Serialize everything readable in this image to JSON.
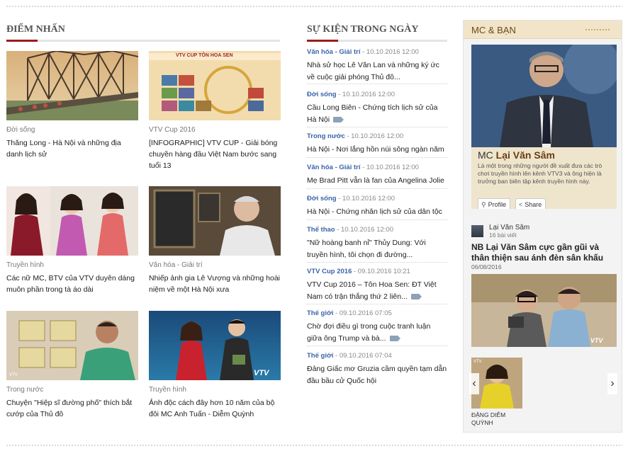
{
  "highlights": {
    "title": "ĐIỂM NHẤN",
    "items": [
      {
        "category": "Đời sống",
        "title": "Thăng Long - Hà Nội và những địa danh lịch sử"
      },
      {
        "category": "VTV Cup 2016",
        "title": "[INFOGRAPHIC] VTV CUP - Giải bóng chuyền hàng đầu Việt Nam bước sang tuổi 13",
        "img_text": "VTV CUP TÔN HOA SEN"
      },
      {
        "category": "Truyền hình",
        "title": "Các nữ MC, BTV của VTV duyên dáng muôn phần trong tà áo dài"
      },
      {
        "category": "Văn hóa - Giải trí",
        "title": "Nhiếp ảnh gia Lê Vượng và những hoài niệm về một Hà Nội xưa"
      },
      {
        "category": "Trong nước",
        "title": "Chuyện \"Hiệp sĩ đường phố\" thích bắt cướp của Thủ đô",
        "img_text": "VTV"
      },
      {
        "category": "Truyền hình",
        "title": "Ảnh độc cách đây hơn 10 năm của bộ đôi MC Anh Tuấn - Diễm Quỳnh",
        "img_text": "VTV"
      }
    ]
  },
  "events": {
    "title": "SỰ KIỆN TRONG NGÀY",
    "items": [
      {
        "category": "Văn hóa - Giải trí",
        "time": " - 10.10.2016 12:00",
        "title": "Nhà sử học Lê Văn Lan và những ký ức về cuộc giải phóng Thủ đô..."
      },
      {
        "category": "Đời sống",
        "time": " - 10.10.2016 12:00",
        "title": "Cầu Long Biên - Chứng tích lịch sử của Hà Nội"
      },
      {
        "category": "Trong nước",
        "time": " - 10.10.2016 12:00",
        "title": "Hà Nội - Nơi lắng hồn núi sông ngàn năm"
      },
      {
        "category": "Văn hóa - Giải trí",
        "time": " - 10.10.2016 12:00",
        "title": "Mẹ Brad Pitt vẫn là fan của Angelina Jolie"
      },
      {
        "category": "Đời sống",
        "time": " - 10.10.2016 12:00",
        "title": "Hà Nội - Chứng nhân lịch sử của dân tộc"
      },
      {
        "category": "Thể thao",
        "time": " - 10.10.2016 12:00",
        "title": "\"Nữ hoàng banh nỉ\" Thủy Dung: Với truyền hình, tôi chọn đi đường..."
      },
      {
        "category": "VTV Cup 2016",
        "time": " - 09.10.2016 10:21",
        "title": "VTV Cup 2016 – Tôn Hoa Sen: ĐT Việt Nam có trận thắng thứ 2 liên..."
      },
      {
        "category": "Thế giới",
        "time": " - 09.10.2016 07:05",
        "title": "Chờ đợi điều gì trong cuộc tranh luận giữa ông Trump và bà..."
      },
      {
        "category": "Thế giới",
        "time": " - 09.10.2016 07:04",
        "title": "Đảng Giấc mơ Gruzia cầm quyền tạm dẫn đầu bầu cử Quốc hội"
      }
    ]
  },
  "mc_panel": {
    "title": "MC & BẠN",
    "featured": {
      "prefix": "MC",
      "name": "Lại Văn Sâm",
      "description": "Là một trong những người đề xuất đưa các trò chơi truyền hình lên kênh VTV3 và ông hiện là trưởng ban biên tập kênh truyền hình này.",
      "profile_label": "Profile",
      "share_label": "Share"
    },
    "author": {
      "name": "Lại Văn Sâm",
      "count": "16 bài viết"
    },
    "article": {
      "title": "NB Lại Văn Sâm cực gần gũi và thân thiện sau ánh đèn sân khấu",
      "date": "06/08/2016",
      "img_text": "VTV"
    },
    "slide": {
      "name": "ĐẶNG DIỄM QUỲNH",
      "img_text": "VTV"
    }
  }
}
